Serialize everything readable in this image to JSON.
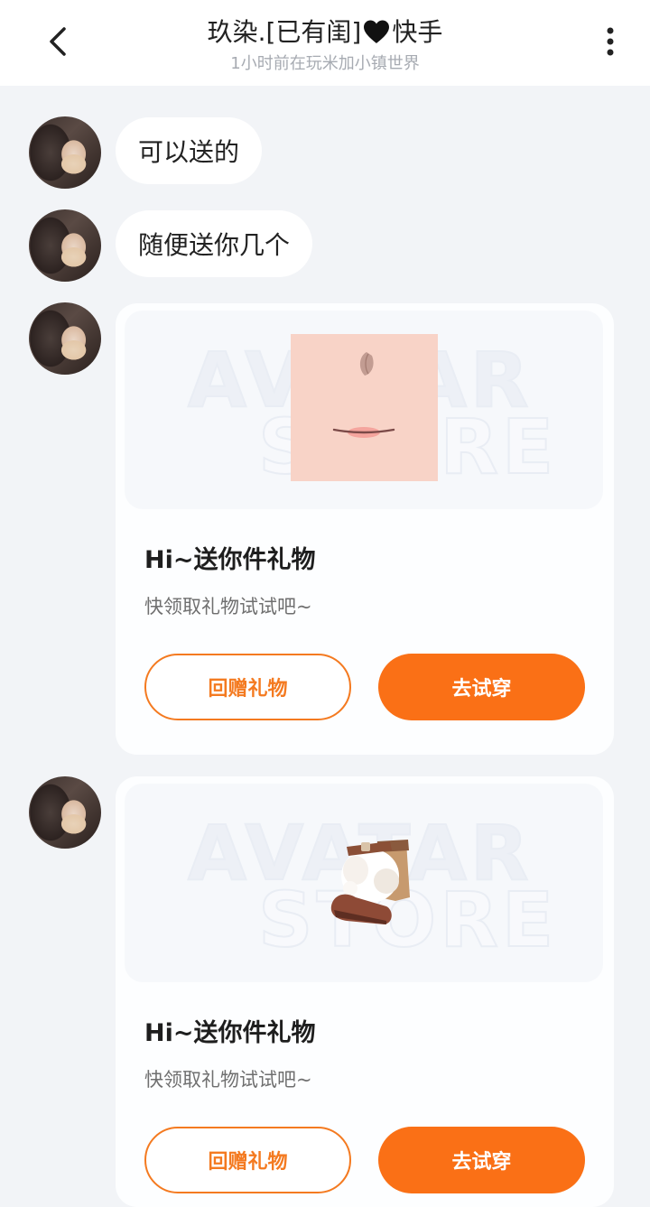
{
  "header": {
    "title_prefix": "玖染.[已有闺]",
    "title_suffix": "快手",
    "subtitle": "1小时前在玩米加小镇世界"
  },
  "messages": [
    {
      "type": "text",
      "text": "可以送的"
    },
    {
      "type": "text",
      "text": "随便送你几个"
    }
  ],
  "gifts": [
    {
      "item_icon": "face-makeup-icon",
      "title": "Hi~送你件礼物",
      "desc": "快领取礼物试试吧~",
      "return_label": "回赠礼物",
      "try_label": "去试穿",
      "watermark_line1": "AVATAR",
      "watermark_line2": "STORE"
    },
    {
      "item_icon": "fur-boots-icon",
      "title": "Hi~送你件礼物",
      "desc": "快领取礼物试试吧~",
      "return_label": "回赠礼物",
      "try_label": "去试穿",
      "watermark_line1": "AVATAR",
      "watermark_line2": "STORE"
    }
  ],
  "colors": {
    "accent": "#fa7016",
    "background": "#f2f4f7"
  }
}
